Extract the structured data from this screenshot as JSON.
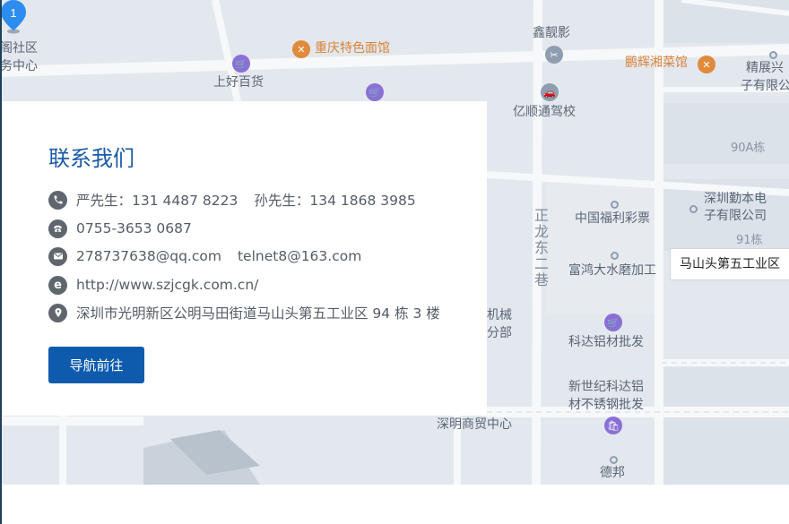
{
  "contact": {
    "title": "联系我们",
    "phone_mobile": "严先生：131 4487 8223",
    "phone_mobile_2": "孙先生：134 1868 3985",
    "phone_landline": "0755-3653 0687",
    "email_1": "278737638@qq.com",
    "email_2": "telnet8@163.com",
    "website": "http://www.szjcgk.com.cn/",
    "address": "深圳市光明新区公明马田街道马山头第五工业区 94 栋 3 楼",
    "nav_button": "导航前往"
  },
  "map": {
    "marker_label": "马山头第五工业区",
    "marker_number": "1",
    "pois": {
      "p1": "阁社区",
      "p2": "务中心",
      "p3": "重庆特色面馆",
      "p4": "鑫靓影",
      "p5": "鹏辉湘菜馆",
      "p6": "精展兴",
      "p7": "子有限公",
      "p8": "上好百货",
      "p9": "亿顺通驾校",
      "p10": "90A栋",
      "p11": "深圳勤本电",
      "p12": "子有限公司",
      "p13": "中国福利彩票",
      "p14": "91栋",
      "p15": "富鸿大水磨加工",
      "p16": "科达铝材批发",
      "p17": "新世纪科达铝",
      "p18": "材不锈钢批发",
      "p19": "深明商贸中心",
      "p20": "德邦",
      "p21": "机械",
      "p22": "分部",
      "road": "正龙东二巷"
    }
  },
  "colors": {
    "accent": "#0e5bad",
    "title": "#1a5aa8",
    "map_bg": "#e3e8ee"
  }
}
